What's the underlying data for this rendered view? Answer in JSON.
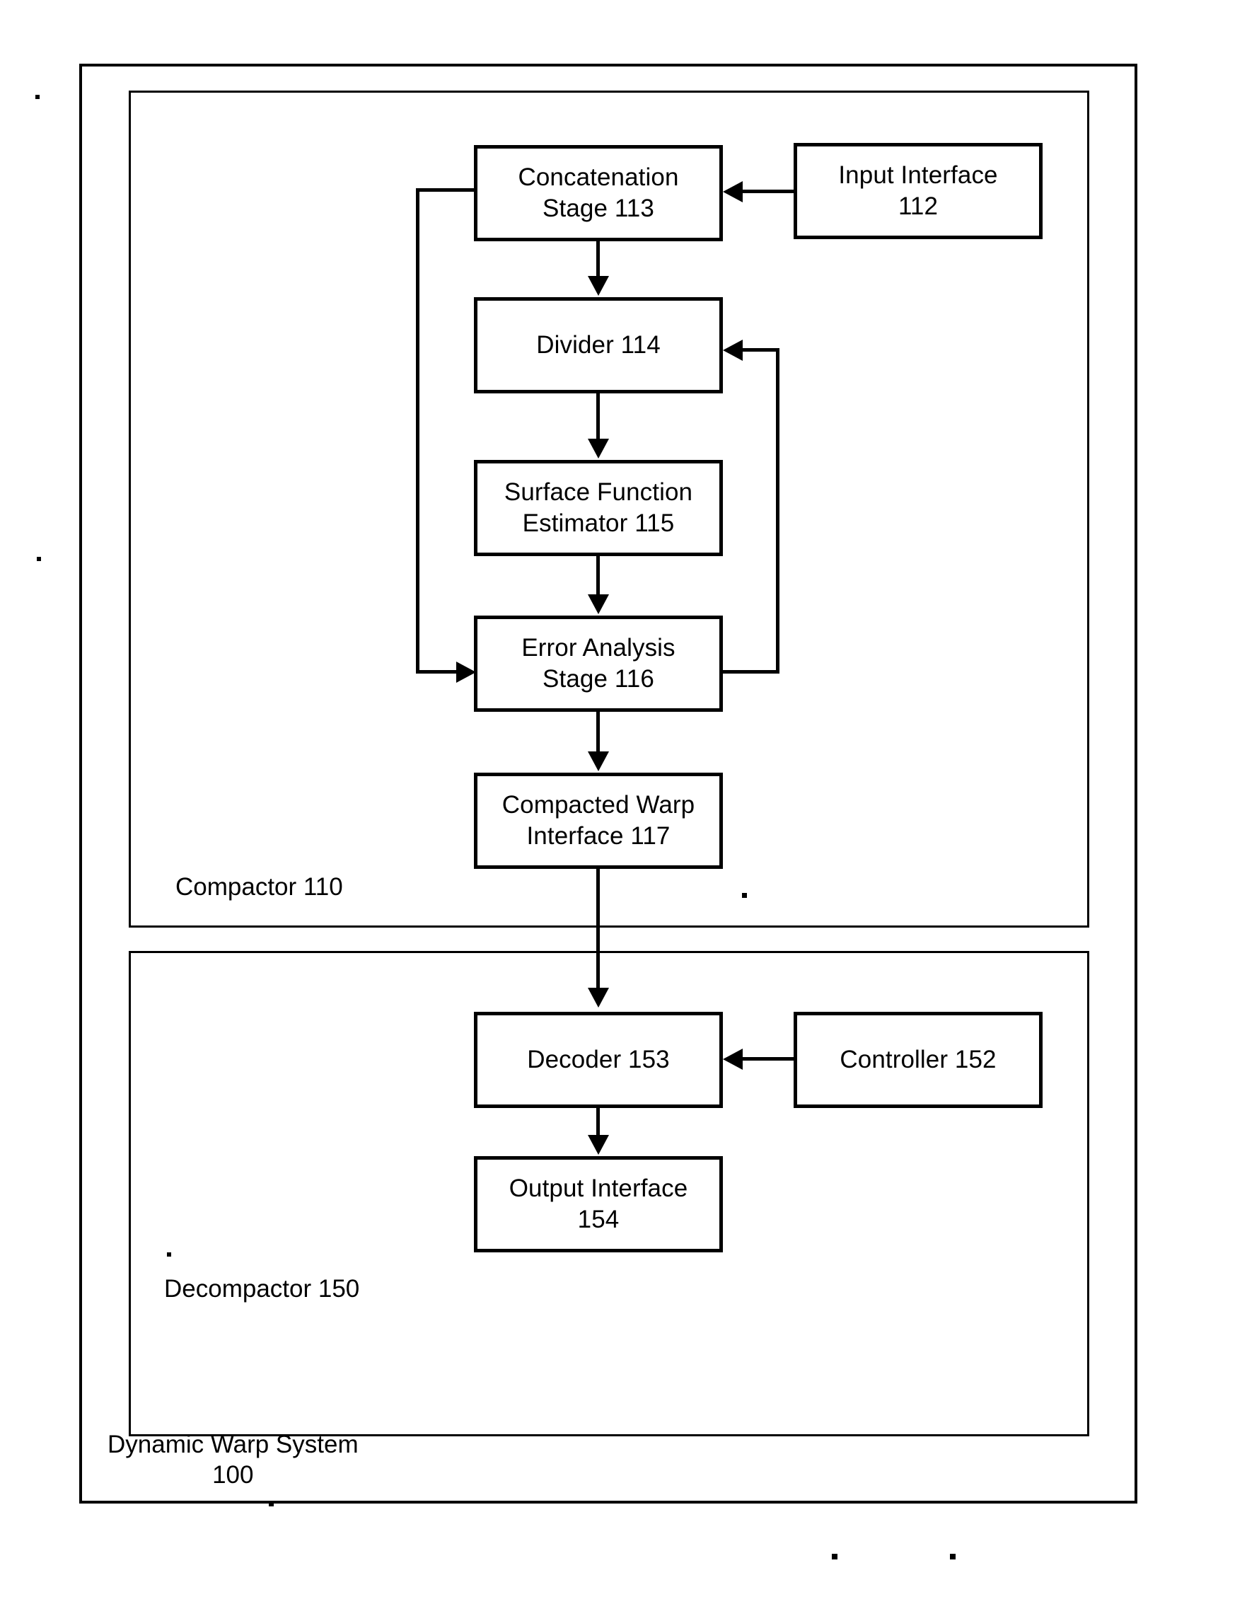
{
  "figure": {
    "system_label": "Dynamic Warp System\n100",
    "compactor_label": "Compactor 110",
    "decompactor_label": "Decompactor 150",
    "ink_color": "#000000",
    "background_color": "#ffffff"
  },
  "nodes": {
    "concatenation": {
      "label": "Concatenation\nStage 113",
      "ref": "113"
    },
    "input_interface": {
      "label": "Input Interface\n112",
      "ref": "112"
    },
    "divider": {
      "label": "Divider 114",
      "ref": "114"
    },
    "surface_function_estimator": {
      "label": "Surface Function\nEstimator 115",
      "ref": "115"
    },
    "error_analysis": {
      "label": "Error Analysis\nStage 116",
      "ref": "116"
    },
    "compacted_warp_interface": {
      "label": "Compacted Warp\nInterface 117",
      "ref": "117"
    },
    "decoder": {
      "label": "Decoder 153",
      "ref": "153"
    },
    "controller": {
      "label": "Controller 152",
      "ref": "152"
    },
    "output_interface": {
      "label": "Output Interface\n154",
      "ref": "154"
    }
  },
  "chart_data": {
    "type": "diagram",
    "title": "Dynamic Warp System 100",
    "containers": [
      {
        "id": "system",
        "label": "Dynamic Warp System 100",
        "children": [
          "compactor",
          "decompactor"
        ]
      },
      {
        "id": "compactor",
        "label": "Compactor 110",
        "children": [
          "112",
          "113",
          "114",
          "115",
          "116",
          "117"
        ]
      },
      {
        "id": "decompactor",
        "label": "Decompactor 150",
        "children": [
          "152",
          "153",
          "154"
        ]
      }
    ],
    "blocks": [
      {
        "id": "112",
        "label": "Input Interface 112"
      },
      {
        "id": "113",
        "label": "Concatenation Stage 113"
      },
      {
        "id": "114",
        "label": "Divider 114"
      },
      {
        "id": "115",
        "label": "Surface Function Estimator 115"
      },
      {
        "id": "116",
        "label": "Error Analysis Stage 116"
      },
      {
        "id": "117",
        "label": "Compacted Warp Interface 117"
      },
      {
        "id": "152",
        "label": "Controller 152"
      },
      {
        "id": "153",
        "label": "Decoder 153"
      },
      {
        "id": "154",
        "label": "Output Interface 154"
      }
    ],
    "edges": [
      {
        "from": "112",
        "to": "113",
        "style": "arrow-left"
      },
      {
        "from": "113",
        "to": "114",
        "style": "arrow-down"
      },
      {
        "from": "114",
        "to": "115",
        "style": "arrow-down"
      },
      {
        "from": "115",
        "to": "116",
        "style": "arrow-down"
      },
      {
        "from": "116",
        "to": "117",
        "style": "arrow-down"
      },
      {
        "from": "113",
        "to": "116",
        "style": "feedback-left"
      },
      {
        "from": "116",
        "to": "114",
        "style": "feedback-right"
      },
      {
        "from": "117",
        "to": "153",
        "style": "arrow-down-cross-container"
      },
      {
        "from": "152",
        "to": "153",
        "style": "arrow-left"
      },
      {
        "from": "153",
        "to": "154",
        "style": "arrow-down"
      }
    ]
  }
}
